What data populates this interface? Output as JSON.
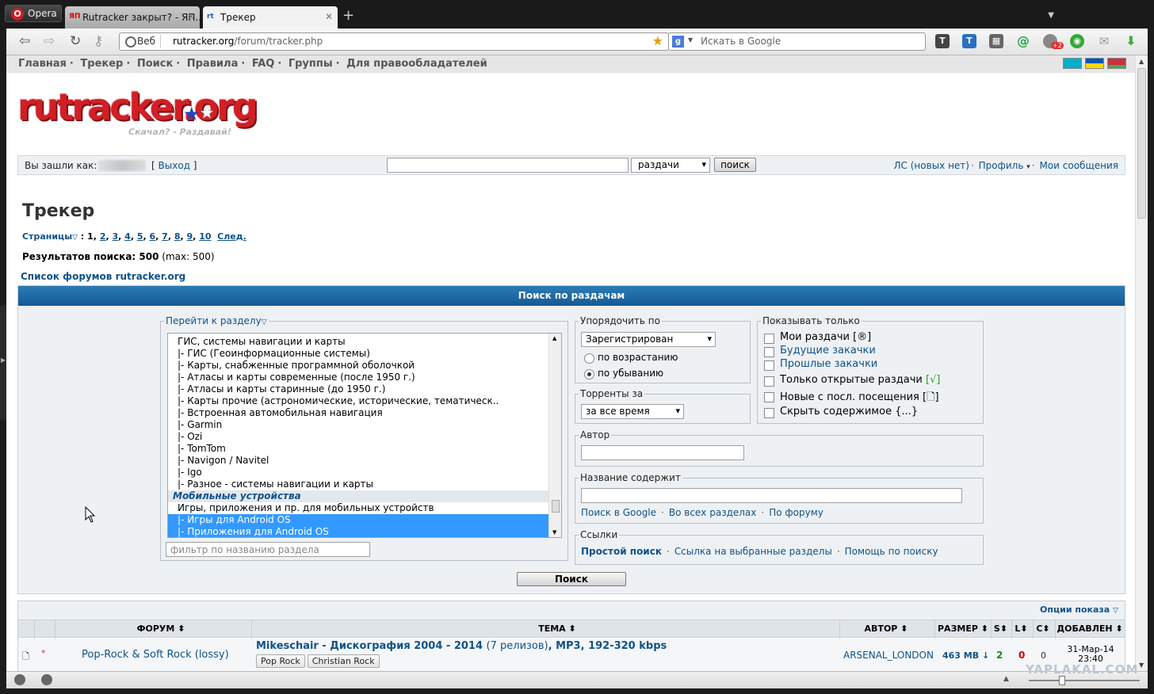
{
  "browser": {
    "opera_label": "Opera",
    "tabs": [
      {
        "title": "Rutracker закрыт? - ЯП...",
        "favicon": "ЯП"
      },
      {
        "title": "Трекер",
        "favicon": "rt"
      }
    ],
    "new_tab": "+",
    "url_badge": "Веб",
    "url_domain": "rutracker.org",
    "url_path": "/forum/tracker.php",
    "search_placeholder": "Искать в Google",
    "ext_badge": "+2"
  },
  "site": {
    "nav": [
      "Главная",
      "Трекер",
      "Поиск",
      "Правила",
      "FAQ",
      "Группы",
      "Для правообладателей"
    ],
    "nav_sep": "·",
    "logo_text": "rutracker.org",
    "slogan": "Скачал? - Раздавай!",
    "userbar": {
      "logged_as": "Вы зашли как:",
      "logout_open": "[",
      "logout": "Выход",
      "logout_close": "]",
      "search_type": "раздачи",
      "search_button": "поиск",
      "pm": "ЛС (новых нет)",
      "profile": "Профиль",
      "my_posts": "Мои сообщения"
    },
    "title": "Трекер",
    "pages_label": "Страницы",
    "pages": [
      "2",
      "3",
      "4",
      "5",
      "6",
      "7",
      "8",
      "9",
      "10"
    ],
    "current_page": "1",
    "next": "След.",
    "results_label": "Результатов поиска: 500",
    "results_max": "(max: 500)",
    "forum_list_link": "Список форумов rutracker.org"
  },
  "search_panel": {
    "header": "Поиск по раздачам",
    "goto_section": "Перейти к разделу",
    "section_list": [
      {
        "text": "ГИС, системы навигации и карты",
        "kind": "sub"
      },
      {
        "text": "|- ГИС (Геоинформационные системы)",
        "kind": "item"
      },
      {
        "text": "|- Карты, снабженные программной оболочкой",
        "kind": "item"
      },
      {
        "text": "|- Атласы и карты современные (после 1950 г.)",
        "kind": "item"
      },
      {
        "text": "|- Атласы и карты старинные (до 1950 г.)",
        "kind": "item"
      },
      {
        "text": "|- Карты прочие (астрономические, исторические, тематическ..",
        "kind": "item"
      },
      {
        "text": "|- Встроенная автомобильная навигация",
        "kind": "item"
      },
      {
        "text": "|- Garmin",
        "kind": "item"
      },
      {
        "text": "|- Ozi",
        "kind": "item"
      },
      {
        "text": "|- TomTom",
        "kind": "item"
      },
      {
        "text": "|- Navigon / Navitel",
        "kind": "item"
      },
      {
        "text": "|- Igo",
        "kind": "item"
      },
      {
        "text": "|- Разное - системы навигации и карты",
        "kind": "item"
      },
      {
        "text": "Мобильные устройства",
        "kind": "cat"
      },
      {
        "text": "Игры, приложения и пр. для мобильных устройств",
        "kind": "sub"
      },
      {
        "text": "|- Игры для Android OS",
        "kind": "sel"
      },
      {
        "text": "|- Приложения для Android OS",
        "kind": "sel"
      }
    ],
    "filter_placeholder": "фильтр по названию раздела",
    "order_by": "Упорядочить по",
    "order_value": "Зарегистрирован",
    "asc": "по возрастанию",
    "desc": "по убыванию",
    "torrents_for": "Торренты за",
    "period_value": "за все время",
    "show_only": "Показывать только",
    "show_options": [
      {
        "label": "Мои раздачи",
        "suffix": "[®]",
        "link": false
      },
      {
        "label": "Будущие закачки",
        "suffix": "",
        "link": true
      },
      {
        "label": "Прошлые закачки",
        "suffix": "",
        "link": true
      },
      {
        "label": "Только открытые раздачи",
        "suffix": "[√]",
        "link": false
      },
      {
        "label": "Новые с посл. посещения",
        "suffix": "[🗋]",
        "link": false
      },
      {
        "label": "Скрыть содержимое",
        "suffix": "{...}",
        "link": false
      }
    ],
    "author": "Автор",
    "title_contains": "Название содержит",
    "title_links": [
      "Поиск в Google",
      "Во всех разделах",
      "По форуму"
    ],
    "links_label": "Ссылки",
    "links": [
      "Простой поиск",
      "Ссылка на выбранные разделы",
      "Помощь по поиску"
    ],
    "search_button": "Поиск"
  },
  "results": {
    "show_options": "Опции показа",
    "columns": {
      "forum": "ФОРУМ",
      "topic": "ТЕМА",
      "author": "АВТОР",
      "size": "РАЗМЕР",
      "s": "S",
      "l": "L",
      "c": "C",
      "added": "ДОБАВЛЕН"
    },
    "sort_mark": "⬍",
    "rows": [
      {
        "forum": "Pop-Rock & Soft Rock (lossy)",
        "title_main": "Mikeschair - Дискография 2004 - 2014",
        "title_releases": "(7 релизов)",
        "title_tail": ", MP3, 192-320 kbps",
        "tags": [
          "Pop Rock",
          "Christian Rock"
        ],
        "author": "ARSENAL_LONDON",
        "size": "463 MB ↓",
        "seeders": "2",
        "leechers": "0",
        "completed": "0",
        "added_date": "31-Мар-14",
        "added_time": "23:40"
      }
    ]
  },
  "watermark": "YAPLAKAL.COM"
}
